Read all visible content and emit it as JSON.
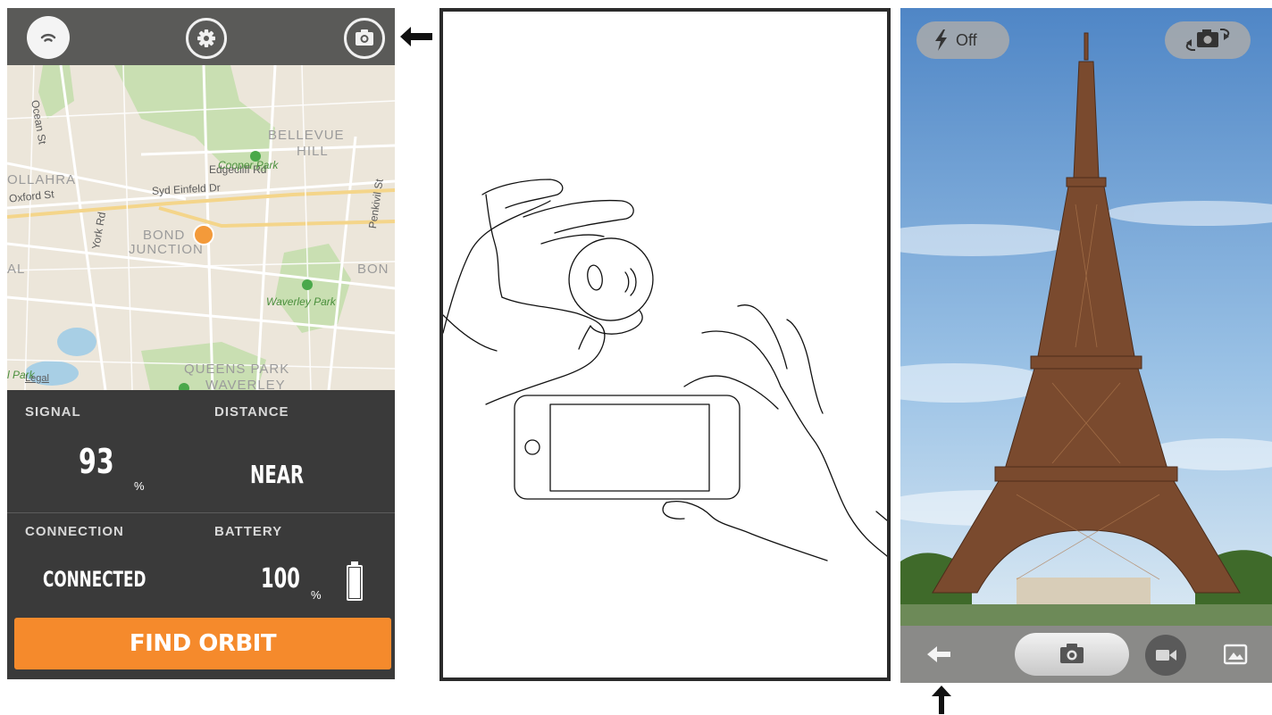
{
  "orbit_app": {
    "map": {
      "streets": [
        "Ocean St",
        "Edgecliff Rd",
        "Syd Einfeld Dr",
        "Oxford St",
        "York Rd",
        "Penkivil St"
      ],
      "areas": [
        "BELLEVUE",
        "HILL",
        "OLLAHRA",
        "BOND",
        "JUNCTION",
        "BON",
        "QUEENS PARK",
        "WAVERLEY",
        "AL"
      ],
      "parks": [
        "Cooper Park",
        "Waverley Park",
        "l Park"
      ],
      "legal": "Legal"
    },
    "signal": {
      "label": "SIGNAL",
      "value": "93",
      "unit": "%"
    },
    "distance": {
      "label": "DISTANCE",
      "value": "NEAR"
    },
    "connection": {
      "label": "CONNECTION",
      "value": "CONNECTED"
    },
    "battery": {
      "label": "BATTERY",
      "value": "100",
      "unit": "%",
      "level": 1.0
    },
    "find_button": "FIND ORBIT",
    "colors": {
      "accent": "#f58a2c",
      "panel": "#3a3a3a",
      "topbar": "#5a5a58"
    }
  },
  "camera_app": {
    "flash_label": "Off"
  },
  "icons": [
    "signal-icon",
    "gear-icon",
    "camera-icon",
    "flash-icon",
    "switch-camera-icon",
    "back-arrow-icon",
    "video-icon",
    "gallery-icon",
    "pointer-arrow-left",
    "pointer-arrow-up"
  ]
}
